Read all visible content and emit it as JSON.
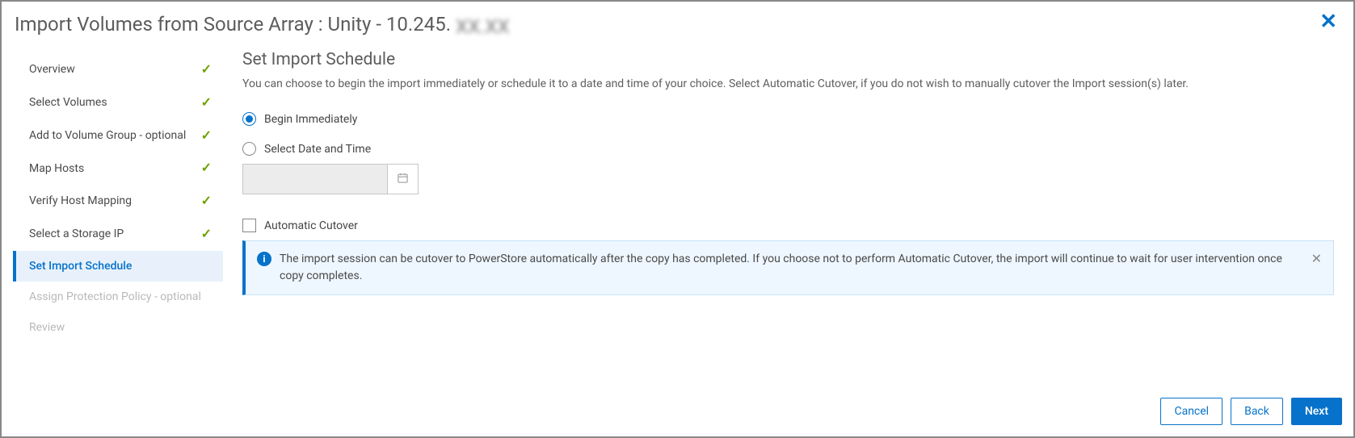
{
  "header": {
    "title": "Import Volumes from Source Array : Unity - 10.245.",
    "redacted_tail": "XX.XX"
  },
  "sidebar": {
    "items": [
      {
        "label": "Overview",
        "state": "done"
      },
      {
        "label": "Select Volumes",
        "state": "done"
      },
      {
        "label": "Add to Volume Group - optional",
        "state": "done"
      },
      {
        "label": "Map Hosts",
        "state": "done"
      },
      {
        "label": "Verify Host Mapping",
        "state": "done"
      },
      {
        "label": "Select a Storage IP",
        "state": "done"
      },
      {
        "label": "Set Import Schedule",
        "state": "active"
      },
      {
        "label": "Assign Protection Policy - optional",
        "state": "disabled"
      },
      {
        "label": "Review",
        "state": "disabled"
      }
    ]
  },
  "content": {
    "title": "Set Import Schedule",
    "description": "You can choose to begin the import immediately or schedule it to a date and time of your choice. Select Automatic Cutover, if you do not wish to manually cutover the Import session(s) later.",
    "option_begin": "Begin Immediately",
    "option_schedule": "Select Date and Time",
    "date_value": "",
    "checkbox_auto_cutover": "Automatic Cutover",
    "info_text": "The import session can be cutover to PowerStore automatically after the copy has completed. If you choose not to perform Automatic Cutover, the import will continue to wait for user intervention once copy completes."
  },
  "footer": {
    "cancel": "Cancel",
    "back": "Back",
    "next": "Next"
  }
}
